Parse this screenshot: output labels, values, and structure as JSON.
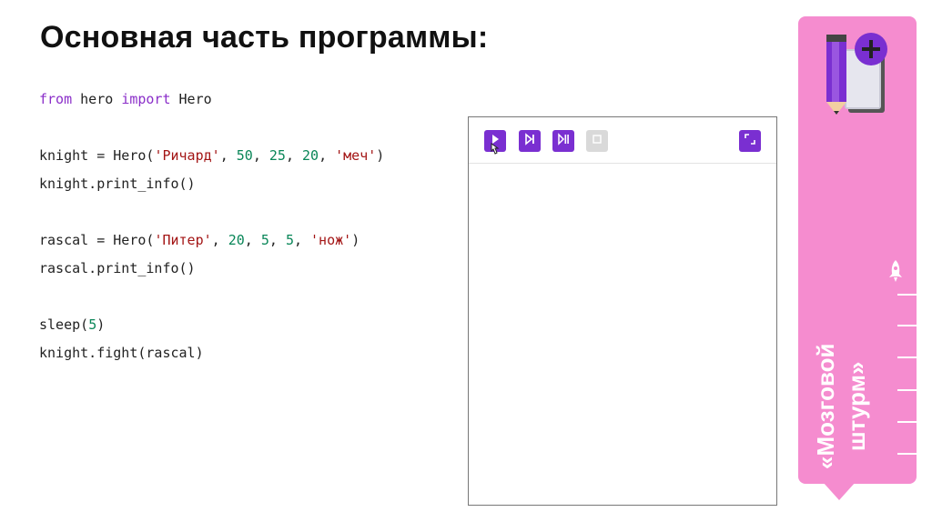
{
  "title": "Основная часть программы:",
  "code": {
    "l1": {
      "kw1": "from",
      "t1": " hero ",
      "kw2": "import",
      "t2": " Hero"
    },
    "l2": {
      "a": "knight = Hero(",
      "s1": "'Ричард'",
      "c1": ", ",
      "n1": "50",
      "c2": ", ",
      "n2": "25",
      "c3": ", ",
      "n3": "20",
      "c4": ", ",
      "s2": "'меч'",
      "z": ")"
    },
    "l3": "knight.print_info()",
    "l4": {
      "a": "rascal = Hero(",
      "s1": "'Питер'",
      "c1": ", ",
      "n1": "20",
      "c2": ", ",
      "n2": "5",
      "c3": ", ",
      "n3": "5",
      "c4": ", ",
      "s2": "'нож'",
      "z": ")"
    },
    "l5": "rascal.print_info()",
    "l6": {
      "a": "sleep(",
      "n1": "5",
      "z": ")"
    },
    "l7": "knight.fight(rascal)"
  },
  "toolbar": {
    "run_icon": "play-icon",
    "step_icon": "step-icon",
    "step_all_icon": "skip-icon",
    "stop_icon": "stop-icon",
    "fullscreen_icon": "fullscreen-icon"
  },
  "sidebar": {
    "line1": "«Мозговой",
    "line2": "штурм»",
    "icons": [
      "notebook-pencil-icon",
      "rocket-icon"
    ]
  },
  "colors": {
    "accent": "#7a2fd1",
    "sidebar": "#f58ccf",
    "keyword": "#8b2fc9",
    "string": "#a31515",
    "number": "#098658"
  }
}
